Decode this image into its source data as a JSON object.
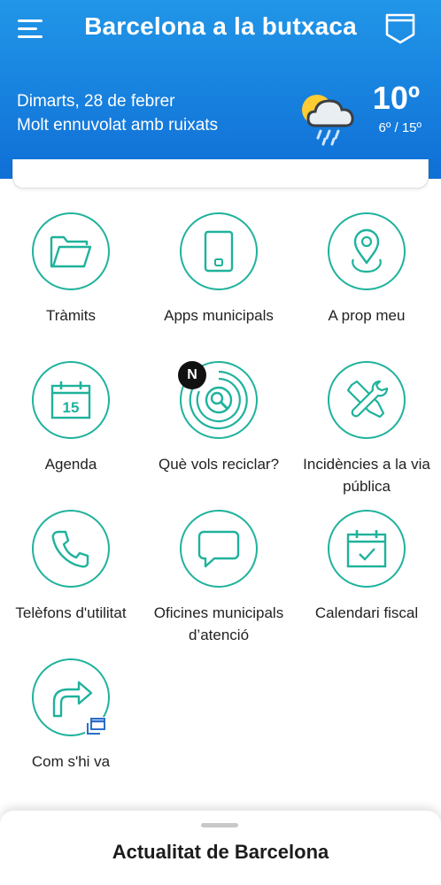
{
  "header": {
    "title": "Barcelona a la butxaca",
    "menu_icon": "hamburger-menu-icon",
    "pocket_icon": "pocket-icon",
    "background_color": "#1a84e0"
  },
  "weather": {
    "date": "Dimarts, 28 de febrer",
    "description": "Molt ennuvolat amb ruixats",
    "temperature": "10º",
    "min_max": "6º / 15º",
    "icon": "sun-cloud-rain-icon"
  },
  "tiles": [
    {
      "label": "Tràmits",
      "icon": "folder-icon"
    },
    {
      "label": "Apps municipals",
      "icon": "smartphone-icon"
    },
    {
      "label": "A prop meu",
      "icon": "location-pin-icon"
    },
    {
      "label": "Agenda",
      "icon": "calendar-15-icon"
    },
    {
      "label": "Què vols reciclar?",
      "icon": "recycle-search-icon",
      "badge": "N"
    },
    {
      "label": "Incidències a la via pública",
      "icon": "tools-icon"
    },
    {
      "label": "Telèfons d'utilitat",
      "icon": "phone-icon"
    },
    {
      "label": "Oficines municipals d’atenció",
      "icon": "chat-bubble-icon"
    },
    {
      "label": "Calendari fiscal",
      "icon": "calendar-check-icon"
    },
    {
      "label": "Com s'hi va",
      "icon": "turn-right-arrow-icon",
      "external": "external-window-icon"
    }
  ],
  "bottom_sheet": {
    "title": "Actualitat de Barcelona"
  },
  "colors": {
    "accent": "#1fb29c",
    "header_blue": "#1a84e0"
  }
}
